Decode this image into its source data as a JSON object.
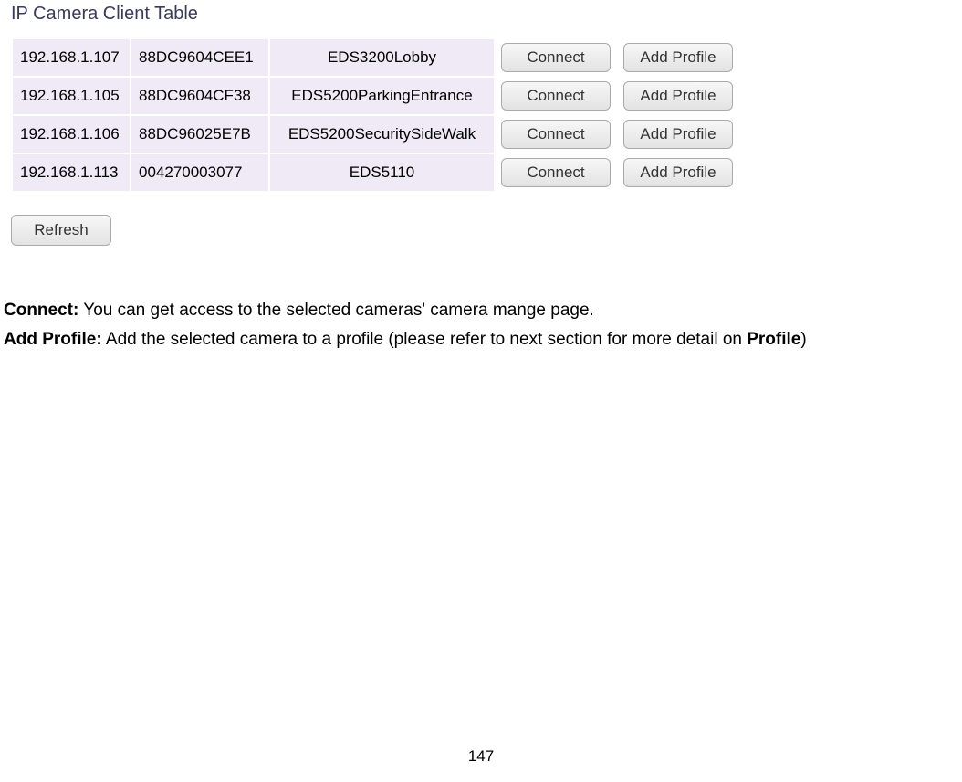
{
  "title": "IP Camera Client Table",
  "rows": [
    {
      "ip": "192.168.1.107",
      "mac": "88DC9604CEE1",
      "name": "EDS3200Lobby",
      "connect": "Connect",
      "addProfile": "Add Profile"
    },
    {
      "ip": "192.168.1.105",
      "mac": "88DC9604CF38",
      "name": "EDS5200ParkingEntrance",
      "connect": "Connect",
      "addProfile": "Add Profile"
    },
    {
      "ip": "192.168.1.106",
      "mac": "88DC96025E7B",
      "name": "EDS5200SecuritySideWalk",
      "connect": "Connect",
      "addProfile": "Add Profile"
    },
    {
      "ip": "192.168.1.113",
      "mac": "004270003077",
      "name": "EDS5110",
      "connect": "Connect",
      "addProfile": "Add Profile"
    }
  ],
  "refreshLabel": "Refresh",
  "description": {
    "connect": {
      "label": "Connect:",
      "text": " You can get access to the selected cameras' camera mange page."
    },
    "addProfile": {
      "label": "Add Profile:",
      "text1": " Add the selected camera to a profile (please refer to next section for more detail on ",
      "bold": "Profile",
      "text2": ")"
    }
  },
  "pageNumber": "147"
}
